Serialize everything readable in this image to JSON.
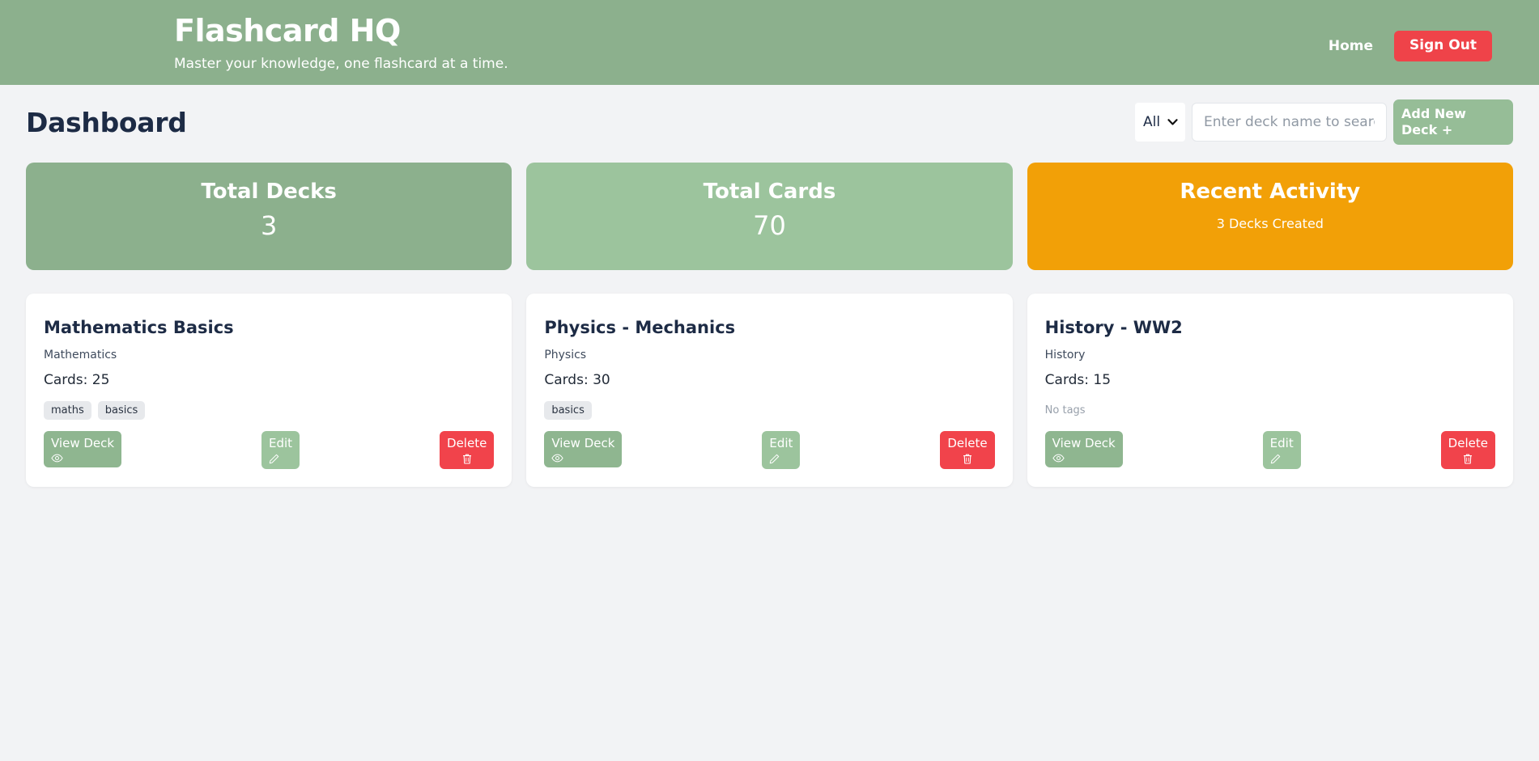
{
  "header": {
    "brand_title": "Flashcard HQ",
    "tagline": "Master your knowledge, one flashcard at a time.",
    "nav": {
      "home_label": "Home",
      "signout_label": "Sign Out"
    },
    "bg_color": "#8cb08d",
    "signout_color": "#ef4349"
  },
  "toolbar": {
    "page_title": "Dashboard",
    "filter": {
      "selected": "All",
      "options": [
        "All"
      ]
    },
    "search": {
      "value": "",
      "placeholder": "Enter deck name to search..."
    },
    "add_deck_label": "Add New Deck",
    "add_deck_icon": "+"
  },
  "stats": [
    {
      "title": "Total Decks",
      "value": "3",
      "color": "#8cb08d",
      "size": "large"
    },
    {
      "title": "Total Cards",
      "value": "70",
      "color": "#9cc49d",
      "size": "large"
    },
    {
      "title": "Recent Activity",
      "value": "3 Decks Created",
      "color": "#f2a007",
      "size": "small"
    }
  ],
  "decks": [
    {
      "title": "Mathematics Basics",
      "subject": "Mathematics",
      "cards_label": "Cards: 25",
      "tags": [
        "maths",
        "basics"
      ],
      "no_tags_label": "",
      "actions": {
        "view": "View Deck",
        "edit": "Edit",
        "delete": "Delete"
      }
    },
    {
      "title": "Physics - Mechanics",
      "subject": "Physics",
      "cards_label": "Cards: 30",
      "tags": [
        "basics"
      ],
      "no_tags_label": "",
      "actions": {
        "view": "View Deck",
        "edit": "Edit",
        "delete": "Delete"
      }
    },
    {
      "title": "History - WW2",
      "subject": "History",
      "cards_label": "Cards: 15",
      "tags": [],
      "no_tags_label": "No tags",
      "actions": {
        "view": "View Deck",
        "edit": "Edit",
        "delete": "Delete"
      }
    }
  ],
  "icons": {
    "eye": "eye-icon",
    "pencil": "pencil-icon",
    "trash": "trash-icon",
    "caret": "chevron-down-icon"
  },
  "page_bg": "#f2f3f5"
}
